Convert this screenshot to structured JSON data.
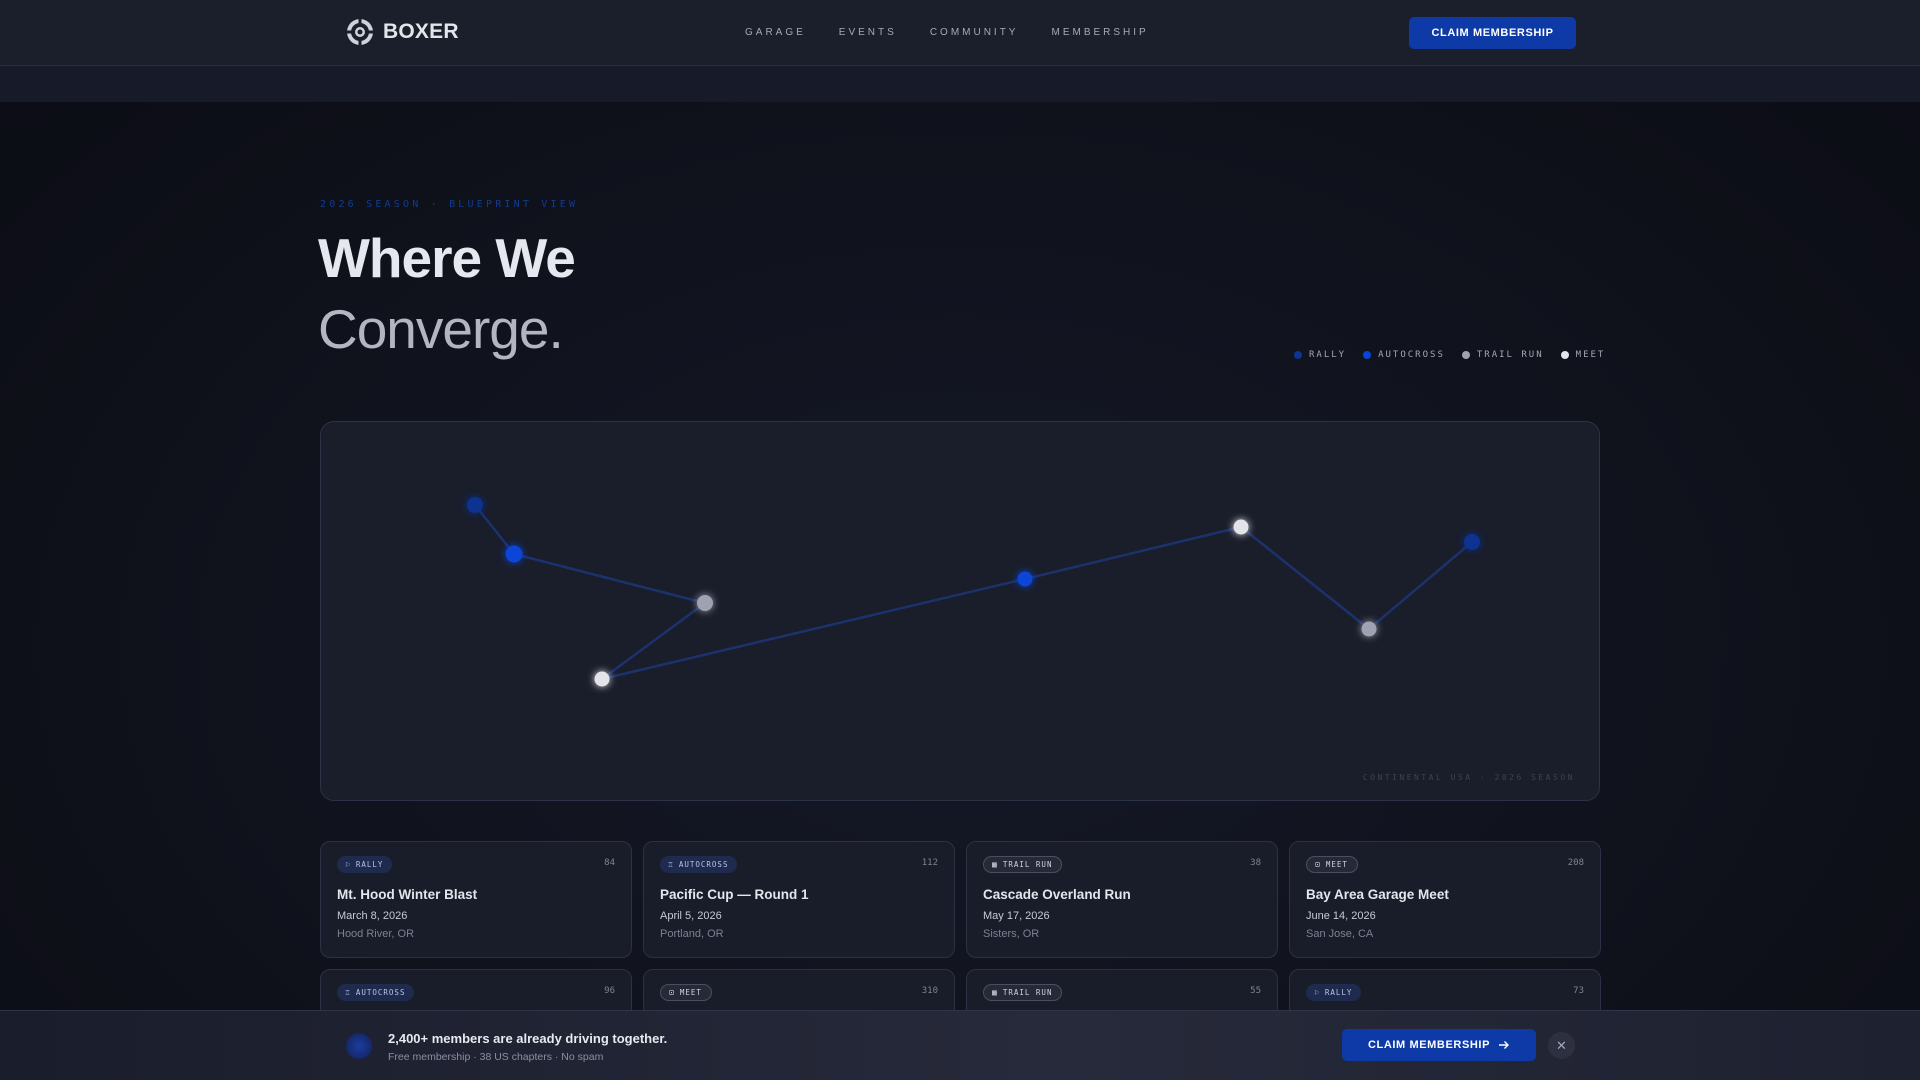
{
  "brand": {
    "name": "BOXER",
    "logo_icon": "aperture-gear-icon"
  },
  "nav": {
    "links": [
      "GARAGE",
      "EVENTS",
      "COMMUNITY",
      "MEMBERSHIP"
    ],
    "cta_label": "CLAIM MEMBERSHIP"
  },
  "hero": {
    "eyebrow": "2026 SEASON · BLUEPRINT VIEW",
    "title_line1": "Where We",
    "title_line2": "Converge."
  },
  "legend": [
    {
      "label": "RALLY",
      "color": "#0e3390"
    },
    {
      "label": "AUTOCROSS",
      "color": "#0a44d6"
    },
    {
      "label": "TRAIL RUN",
      "color": "#9ea2b1"
    },
    {
      "label": "MEET",
      "color": "#e2e4ea"
    }
  ],
  "map": {
    "caption": "CONTINENTAL USA · 2026 SEASON",
    "colors": {
      "rally": "#0e3390",
      "autocross": "#0a44d6",
      "trail": "#9ea2b1",
      "meet": "#e2e4ea",
      "line": "#1d3678"
    }
  },
  "events": [
    {
      "type": "RALLY",
      "kind": "rally",
      "icon": "flag-icon",
      "count": "84",
      "title": "Mt. Hood Winter Blast",
      "date": "March 8, 2026",
      "location": "Hood River, OR"
    },
    {
      "type": "AUTOCROSS",
      "kind": "autocross",
      "icon": "trophy-icon",
      "count": "112",
      "title": "Pacific Cup — Round 1",
      "date": "April 5, 2026",
      "location": "Portland, OR"
    },
    {
      "type": "TRAIL RUN",
      "kind": "trail",
      "icon": "map-icon",
      "count": "38",
      "title": "Cascade Overland Run",
      "date": "May 17, 2026",
      "location": "Sisters, OR"
    },
    {
      "type": "MEET",
      "kind": "meet",
      "icon": "car-icon",
      "count": "208",
      "title": "Bay Area Garage Meet",
      "date": "June 14, 2026",
      "location": "San Jose, CA"
    },
    {
      "type": "AUTOCROSS",
      "kind": "autocross",
      "icon": "trophy-icon",
      "count": "96"
    },
    {
      "type": "MEET",
      "kind": "meet",
      "icon": "car-icon",
      "count": "310"
    },
    {
      "type": "TRAIL RUN",
      "kind": "trail",
      "icon": "map-icon",
      "count": "55"
    },
    {
      "type": "RALLY",
      "kind": "rally",
      "icon": "flag-icon",
      "count": "73"
    }
  ],
  "bottom_bar": {
    "headline": "2,400+ members are already driving together.",
    "sub": "Free membership · 38 US chapters · No spam",
    "cta_label": "CLAIM MEMBERSHIP",
    "cta_icon": "arrow-right-icon",
    "close_icon": "close-icon"
  }
}
